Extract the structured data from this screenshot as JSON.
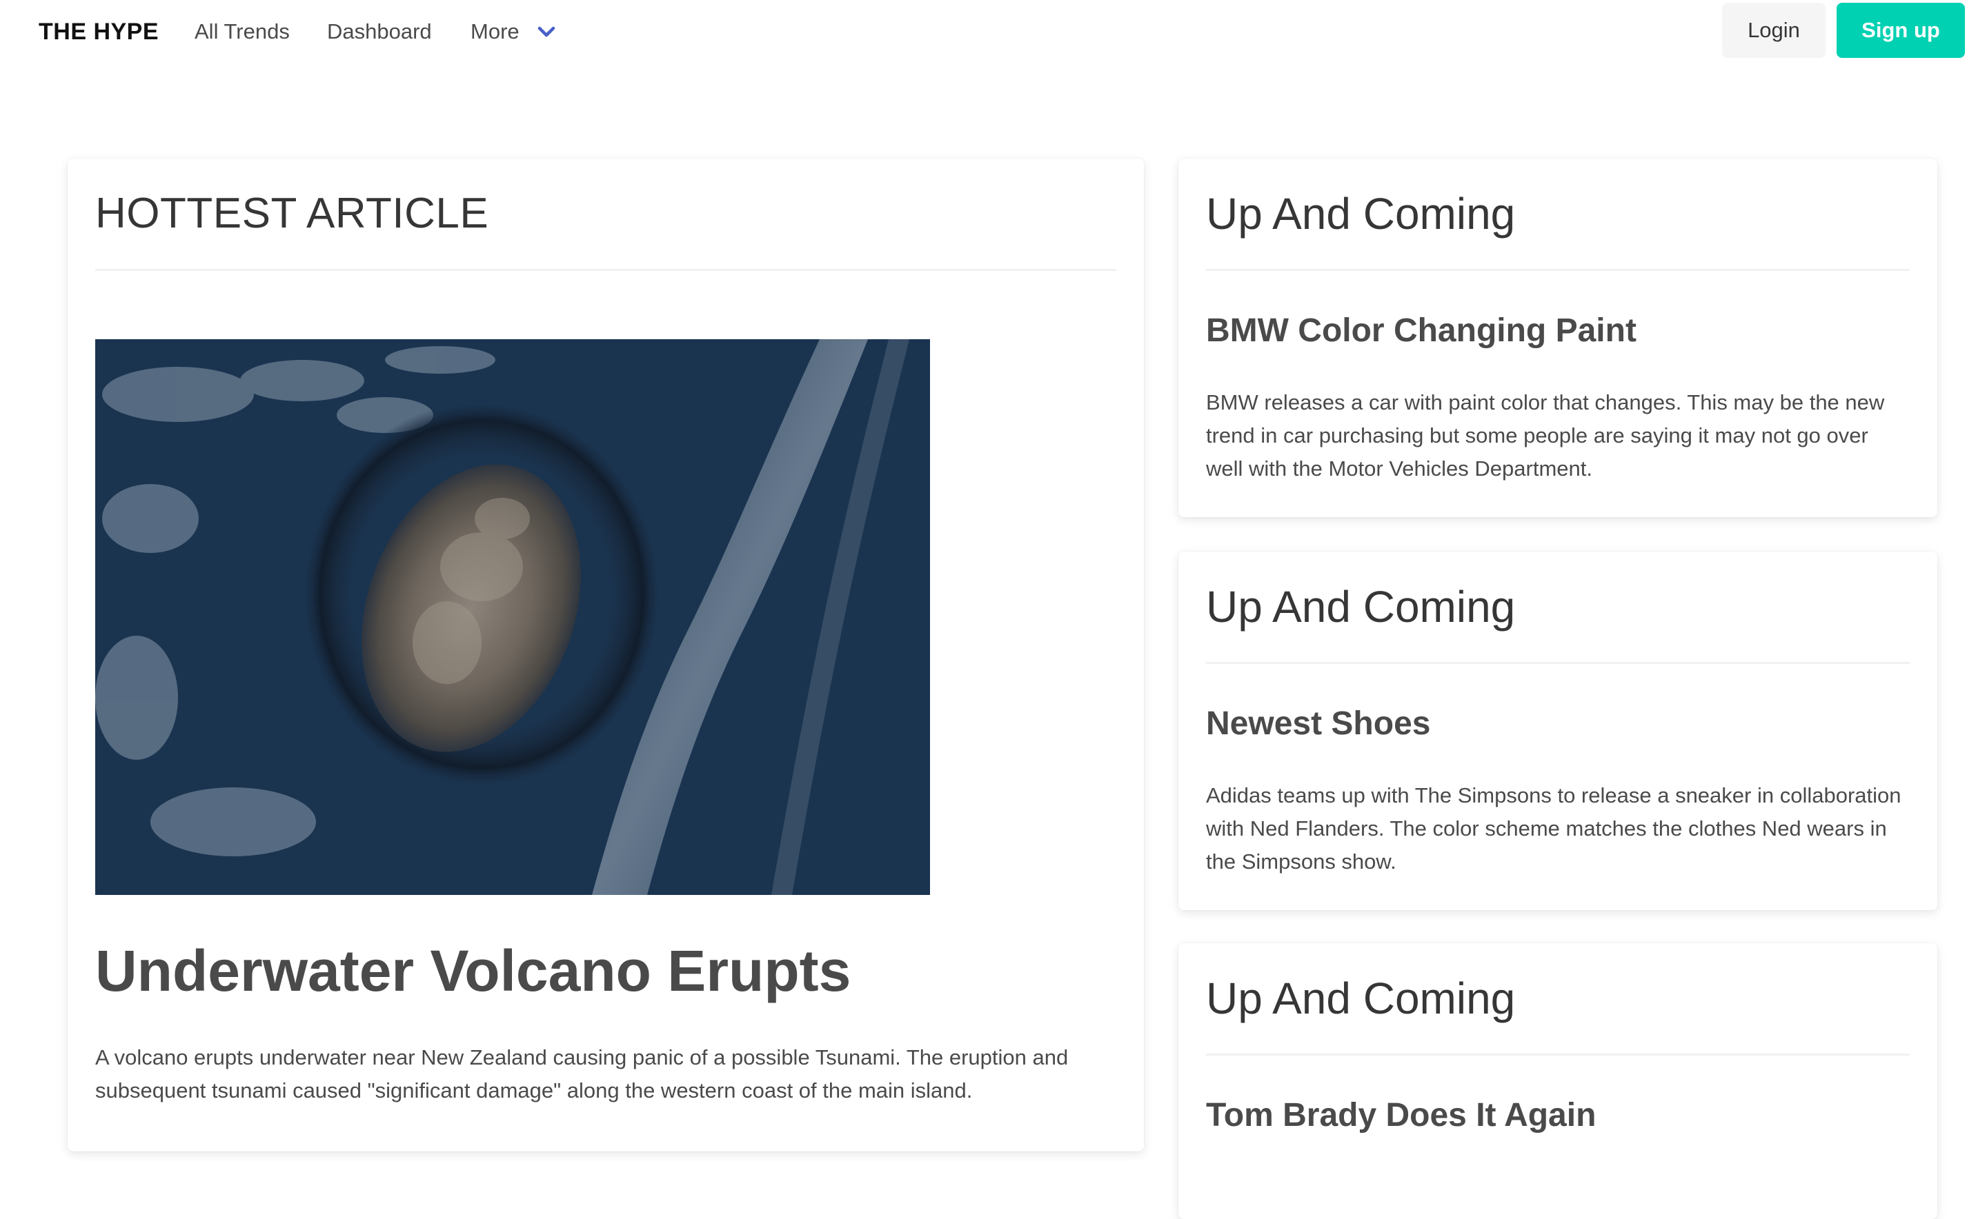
{
  "nav": {
    "brand": "THE HYPE",
    "items": [
      "All Trends",
      "Dashboard",
      "More"
    ],
    "login_label": "Login",
    "signup_label": "Sign up",
    "accent_color": "#00d1b2",
    "chevron_color": "#485fc7"
  },
  "main_card": {
    "heading": "HOTTEST ARTICLE",
    "image_icon": "volcano-eruption-satellite-image",
    "article_title": "Underwater Volcano Erupts",
    "article_text": "A volcano erupts underwater near New Zealand causing panic of a possible Tsunami. The eruption and subsequent tsunami caused \"significant damage\" along the western coast of the main island."
  },
  "side_cards": [
    {
      "heading": "Up And Coming",
      "title": "BMW Color Changing Paint",
      "text": "BMW releases a car with paint color that changes. This may be the new trend in car purchasing but some people are saying it may not go over well with the Motor Vehicles Department."
    },
    {
      "heading": "Up And Coming",
      "title": "Newest Shoes",
      "text": "Adidas teams up with The Simpsons to release a sneaker in collaboration with Ned Flanders. The color scheme matches the clothes Ned wears in the Simpsons show."
    },
    {
      "heading": "Up And Coming",
      "title": "Tom Brady Does It Again",
      "text": ""
    }
  ]
}
